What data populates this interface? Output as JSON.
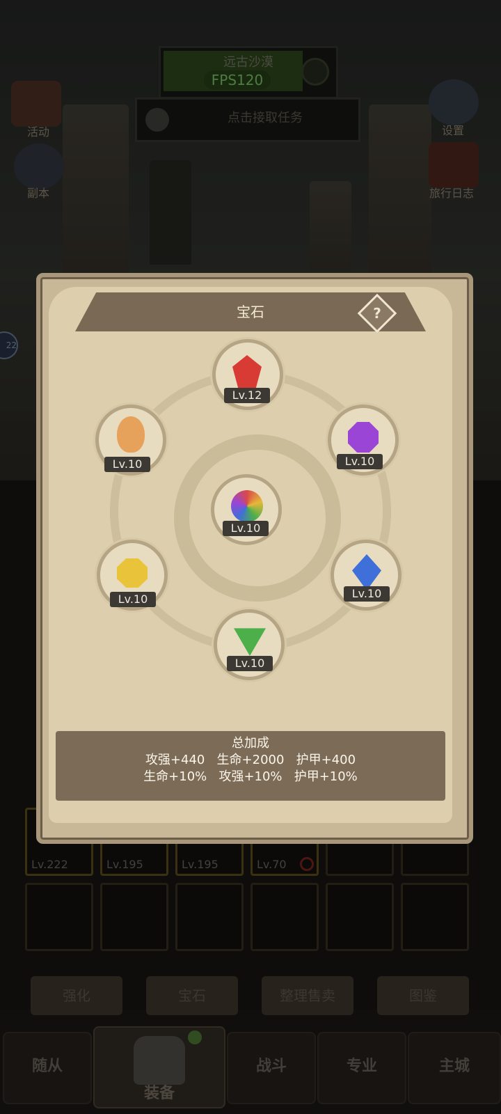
{
  "hud": {
    "map_name": "远古沙漠",
    "fps": "FPS120",
    "quest": "点击接取任务",
    "left_buttons": [
      "活动",
      "副本"
    ],
    "right_buttons": [
      "设置",
      "旅行日志"
    ],
    "side_badge": "22"
  },
  "panel": {
    "title": "宝石",
    "help": "?",
    "gems": [
      {
        "name": "red",
        "level": "Lv.12",
        "color": "#d83a34"
      },
      {
        "name": "orange",
        "level": "Lv.10",
        "color": "#e6a15a"
      },
      {
        "name": "purple",
        "level": "Lv.10",
        "color": "#9a45d6"
      },
      {
        "name": "rainbow",
        "level": "Lv.10",
        "color": "#c86bb8"
      },
      {
        "name": "yellow",
        "level": "Lv.10",
        "color": "#e9c43a"
      },
      {
        "name": "blue",
        "level": "Lv.10",
        "color": "#3f6fd8"
      },
      {
        "name": "green",
        "level": "Lv.10",
        "color": "#4caf4a"
      }
    ],
    "bonus": {
      "heading": "总加成",
      "line1": "攻强+440   生命+2000   护甲+400",
      "line2": "生命+10%   攻强+10%   护甲+10%"
    }
  },
  "inventory": {
    "levels": [
      "Lv.222",
      "Lv.195",
      "Lv.195",
      "Lv.70"
    ]
  },
  "actions": [
    "强化",
    "宝石",
    "整理售卖",
    "图鉴"
  ],
  "nav": [
    "随从",
    "装备",
    "战斗",
    "专业",
    "主城"
  ],
  "colors": {
    "panel": "#ddcfad",
    "bonus_bg": "#7c6b57",
    "accent_green": "#7ec86a"
  }
}
